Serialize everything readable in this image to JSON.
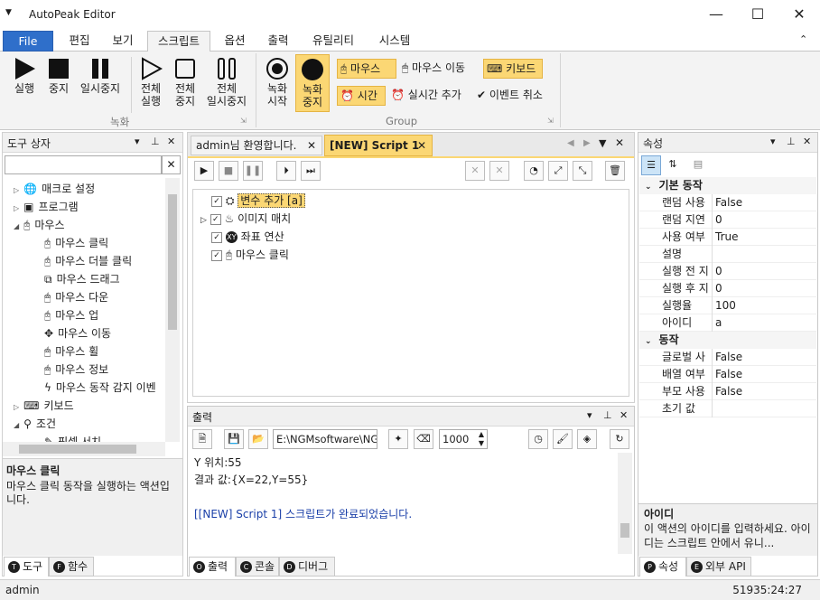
{
  "app": {
    "title": "AutoPeak Editor"
  },
  "menu": {
    "file": "File",
    "edit": "편집",
    "view": "보기",
    "script": "스크립트",
    "options": "옵션",
    "output": "출력",
    "utility": "유틸리티",
    "system": "시스템"
  },
  "ribbon": {
    "run": "실행",
    "stop": "중지",
    "pause": "일시중지",
    "run_all": [
      "전체",
      "실행"
    ],
    "stop_all": [
      "전체",
      "중지"
    ],
    "pause_all": [
      "전체",
      "일시중지"
    ],
    "rec_start": [
      "녹화",
      "시작"
    ],
    "rec_stop": [
      "녹화",
      "중지"
    ],
    "group_record": "녹화",
    "group_group": "Group",
    "mouse": "마우스",
    "mouse_move": "마우스 이동",
    "keyboard": "키보드",
    "time": "시간",
    "realtime_add": "실시간 추가",
    "event_cancel": "이벤트 취소"
  },
  "toolbox": {
    "title": "도구 상자",
    "items": [
      "매크로 설정",
      "프로그램",
      "마우스",
      "마우스 클릭",
      "마우스 더블 클릭",
      "마우스 드래그",
      "마우스 다운",
      "마우스 업",
      "마우스 이동",
      "마우스 휠",
      "마우스 정보",
      "마우스 동작 감지 이벤",
      "키보드",
      "조건",
      "픽셀 서치"
    ],
    "desc_title": "마우스 클릭",
    "desc_text": "마우스 클릭 동작을 실행하는 액션입니다.",
    "tab_tools": "도구",
    "tab_functions": "함수",
    "tab_tools_key": "T",
    "tab_functions_key": "F"
  },
  "editor": {
    "tab_welcome": "admin님 환영합니다.",
    "tab_script": "[NEW] Script 1",
    "steps": [
      "변수 추가 [a]",
      "이미지 매치",
      "좌표 연산",
      "마우스 클릭"
    ]
  },
  "output": {
    "title": "출력",
    "path": "E:\\NGMsoftware\\NG",
    "delay": "1000",
    "lines": [
      "Y 위치:55",
      "결과 값:{X=22,Y=55}",
      "",
      "[[NEW] Script 1] 스크립트가 완료되었습니다."
    ],
    "tab_output": "출력",
    "tab_console": "콘솔",
    "tab_debug": "디버그",
    "tab_output_key": "O",
    "tab_console_key": "C",
    "tab_debug_key": "D"
  },
  "properties": {
    "title": "속성",
    "cat_basic": "기본 동작",
    "basic": [
      {
        "name": "랜덤 사용",
        "value": "False"
      },
      {
        "name": "랜덤 지연",
        "value": "0"
      },
      {
        "name": "사용 여부",
        "value": "True"
      },
      {
        "name": "설명",
        "value": ""
      },
      {
        "name": "실행 전 지",
        "value": "0"
      },
      {
        "name": "실행 후 지",
        "value": "0"
      },
      {
        "name": "실행율",
        "value": "100"
      },
      {
        "name": "아이디",
        "value": "a"
      }
    ],
    "cat_action": "동작",
    "action": [
      {
        "name": "글로벌 사",
        "value": "False"
      },
      {
        "name": "배열 여부",
        "value": "False"
      },
      {
        "name": "부모 사용",
        "value": "False"
      },
      {
        "name": "초기 값",
        "value": ""
      }
    ],
    "desc_title": "아이디",
    "desc_text": "이 액션의 아이디를 입력하세요. 아이디는 스크립트 안에서 유니...",
    "tab_props": "속성",
    "tab_api": "외부 API",
    "tab_props_key": "P",
    "tab_api_key": "E"
  },
  "status": {
    "user": "admin",
    "time": "51935:24:27"
  },
  "colors": {
    "accent": "#2f6fca",
    "highlight": "#fbd774",
    "link_text": "#1a3fa8"
  }
}
